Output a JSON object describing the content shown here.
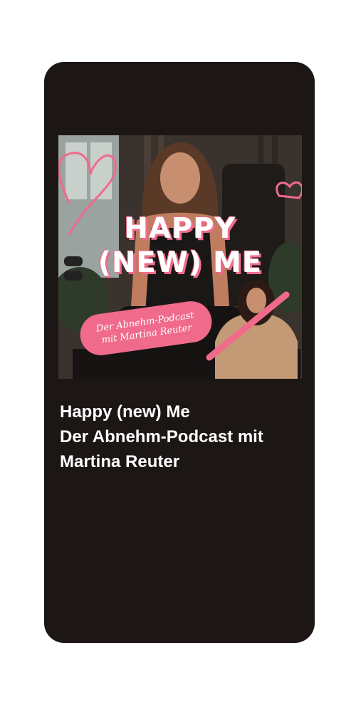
{
  "podcast": {
    "cover": {
      "title_line1": "HAPPY",
      "title_line2": "(NEW) ME",
      "subtitle_line1": "Der Abnehm-Podcast",
      "subtitle_line2": "mit Martina Reuter"
    },
    "title": "Happy (new) Me",
    "subtitle_line1": "Der Abnehm-Podcast mit",
    "subtitle_line2": "Martina Reuter"
  },
  "colors": {
    "card_bg": "#1c1615",
    "accent_pink": "#f06a8c",
    "text": "#ffffff"
  }
}
